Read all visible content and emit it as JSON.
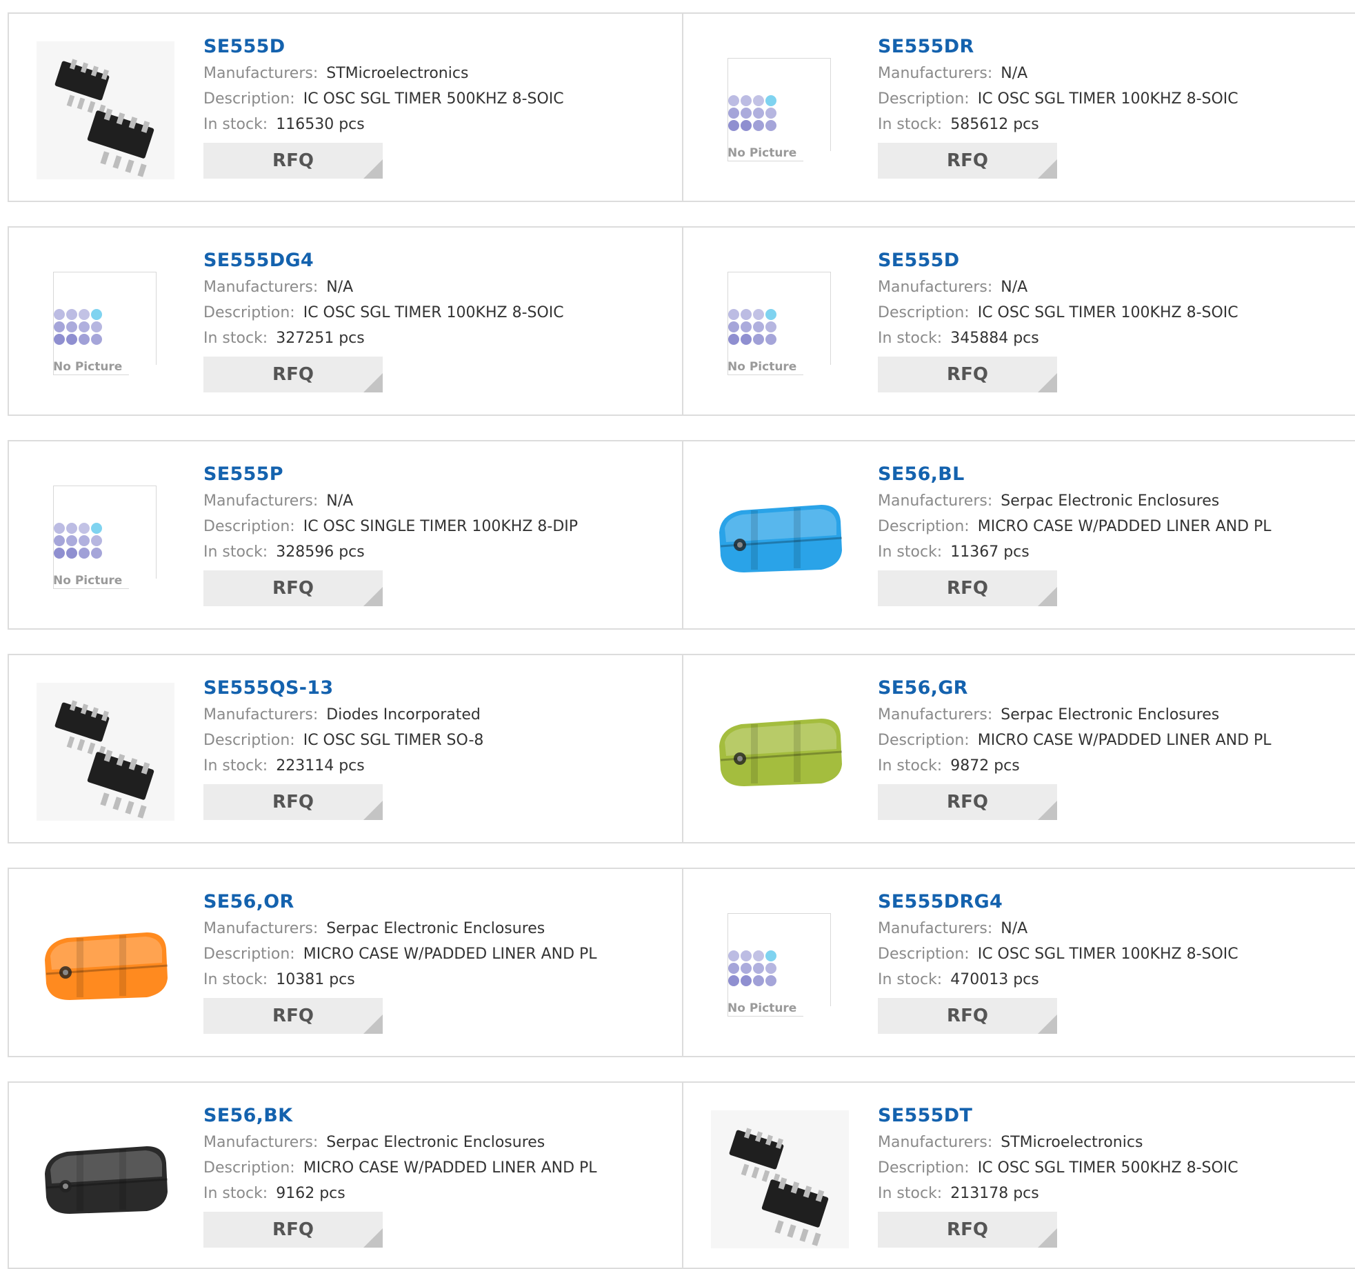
{
  "labels": {
    "manufacturers": "Manufacturers:",
    "description": "Description:",
    "in_stock": "In stock:",
    "rfq": "RFQ",
    "no_picture": "No Picture"
  },
  "colors": {
    "title": "#1462ae",
    "border": "#dcdcdc",
    "rfq_bg": "#ececec",
    "case_blue": "#2aa3e8",
    "case_green": "#a4bd3e",
    "case_orange": "#ff8a1f",
    "case_black": "#2a2a2a"
  },
  "products": [
    {
      "part": "SE555D",
      "manufacturer": "STMicroelectronics",
      "description": "IC OSC SGL TIMER 500KHZ 8-SOIC",
      "stock": "116530 pcs",
      "image": "chip-icon"
    },
    {
      "part": "SE555DR",
      "manufacturer": "N/A",
      "description": "IC OSC SGL TIMER 100KHZ 8-SOIC",
      "stock": "585612 pcs",
      "image": "no-picture-icon"
    },
    {
      "part": "SE555DG4",
      "manufacturer": "N/A",
      "description": "IC OSC SGL TIMER 100KHZ 8-SOIC",
      "stock": "327251 pcs",
      "image": "no-picture-icon"
    },
    {
      "part": "SE555D",
      "manufacturer": "N/A",
      "description": "IC OSC SGL TIMER 100KHZ 8-SOIC",
      "stock": "345884 pcs",
      "image": "no-picture-icon"
    },
    {
      "part": "SE555P",
      "manufacturer": "N/A",
      "description": "IC OSC SINGLE TIMER 100KHZ 8-DIP",
      "stock": "328596 pcs",
      "image": "no-picture-icon"
    },
    {
      "part": "SE56,BL",
      "manufacturer": "Serpac Electronic Enclosures",
      "description": "MICRO CASE W/PADDED LINER AND PL",
      "stock": "11367 pcs",
      "image": "case-blue-icon"
    },
    {
      "part": "SE555QS-13",
      "manufacturer": "Diodes Incorporated",
      "description": "IC OSC SGL TIMER SO-8",
      "stock": "223114 pcs",
      "image": "chip-icon"
    },
    {
      "part": "SE56,GR",
      "manufacturer": "Serpac Electronic Enclosures",
      "description": "MICRO CASE W/PADDED LINER AND PL",
      "stock": "9872 pcs",
      "image": "case-green-icon"
    },
    {
      "part": "SE56,OR",
      "manufacturer": "Serpac Electronic Enclosures",
      "description": "MICRO CASE W/PADDED LINER AND PL",
      "stock": "10381 pcs",
      "image": "case-orange-icon"
    },
    {
      "part": "SE555DRG4",
      "manufacturer": "N/A",
      "description": "IC OSC SGL TIMER 100KHZ 8-SOIC",
      "stock": "470013 pcs",
      "image": "no-picture-icon"
    },
    {
      "part": "SE56,BK",
      "manufacturer": "Serpac Electronic Enclosures",
      "description": "MICRO CASE W/PADDED LINER AND PL",
      "stock": "9162 pcs",
      "image": "case-black-icon"
    },
    {
      "part": "SE555DT",
      "manufacturer": "STMicroelectronics",
      "description": "IC OSC SGL TIMER 500KHZ 8-SOIC",
      "stock": "213178 pcs",
      "image": "chip-icon"
    }
  ]
}
